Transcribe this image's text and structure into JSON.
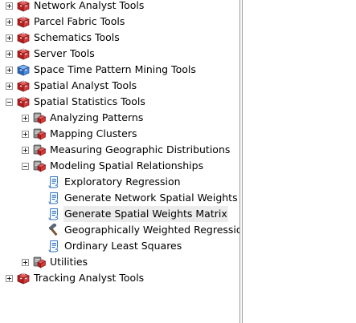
{
  "tree": {
    "items": [
      {
        "label": "Network Analyst Tools",
        "icon": "toolbox-icon",
        "state": "collapsed",
        "level": 0
      },
      {
        "label": "Parcel Fabric Tools",
        "icon": "toolbox-icon",
        "state": "collapsed",
        "level": 0
      },
      {
        "label": "Schematics Tools",
        "icon": "toolbox-icon",
        "state": "collapsed",
        "level": 0
      },
      {
        "label": "Server Tools",
        "icon": "toolbox-icon",
        "state": "collapsed",
        "level": 0
      },
      {
        "label": "Space Time Pattern Mining Tools",
        "icon": "toolbox-blue-icon",
        "state": "collapsed",
        "level": 0
      },
      {
        "label": "Spatial Analyst Tools",
        "icon": "toolbox-icon",
        "state": "collapsed",
        "level": 0
      },
      {
        "label": "Spatial Statistics Tools",
        "icon": "toolbox-icon",
        "state": "expanded",
        "level": 0
      },
      {
        "label": "Analyzing Patterns",
        "icon": "toolset-icon",
        "state": "collapsed",
        "level": 1
      },
      {
        "label": "Mapping Clusters",
        "icon": "toolset-icon",
        "state": "collapsed",
        "level": 1
      },
      {
        "label": "Measuring Geographic Distributions",
        "icon": "toolset-icon",
        "state": "collapsed",
        "level": 1
      },
      {
        "label": "Modeling Spatial Relationships",
        "icon": "toolset-icon",
        "state": "expanded",
        "level": 1
      },
      {
        "label": "Exploratory Regression",
        "icon": "script-tool-icon",
        "state": "leaf",
        "level": 2
      },
      {
        "label": "Generate Network Spatial Weights",
        "icon": "script-tool-icon",
        "state": "leaf",
        "level": 2
      },
      {
        "label": "Generate Spatial Weights Matrix",
        "icon": "script-tool-icon",
        "state": "leaf",
        "level": 2,
        "selected": true
      },
      {
        "label": "Geographically Weighted Regression",
        "icon": "hammer-tool-icon",
        "state": "leaf",
        "level": 2
      },
      {
        "label": "Ordinary Least Squares",
        "icon": "script-tool-icon",
        "state": "leaf",
        "level": 2
      },
      {
        "label": "Utilities",
        "icon": "toolset-icon",
        "state": "collapsed",
        "level": 1
      },
      {
        "label": "Tracking Analyst Tools",
        "icon": "toolbox-icon",
        "state": "collapsed",
        "level": 0
      }
    ]
  },
  "colors": {
    "toolbox_red": "#c1272d",
    "toolbox_blue": "#3a7bd5",
    "selected_bg": "#ececec"
  }
}
